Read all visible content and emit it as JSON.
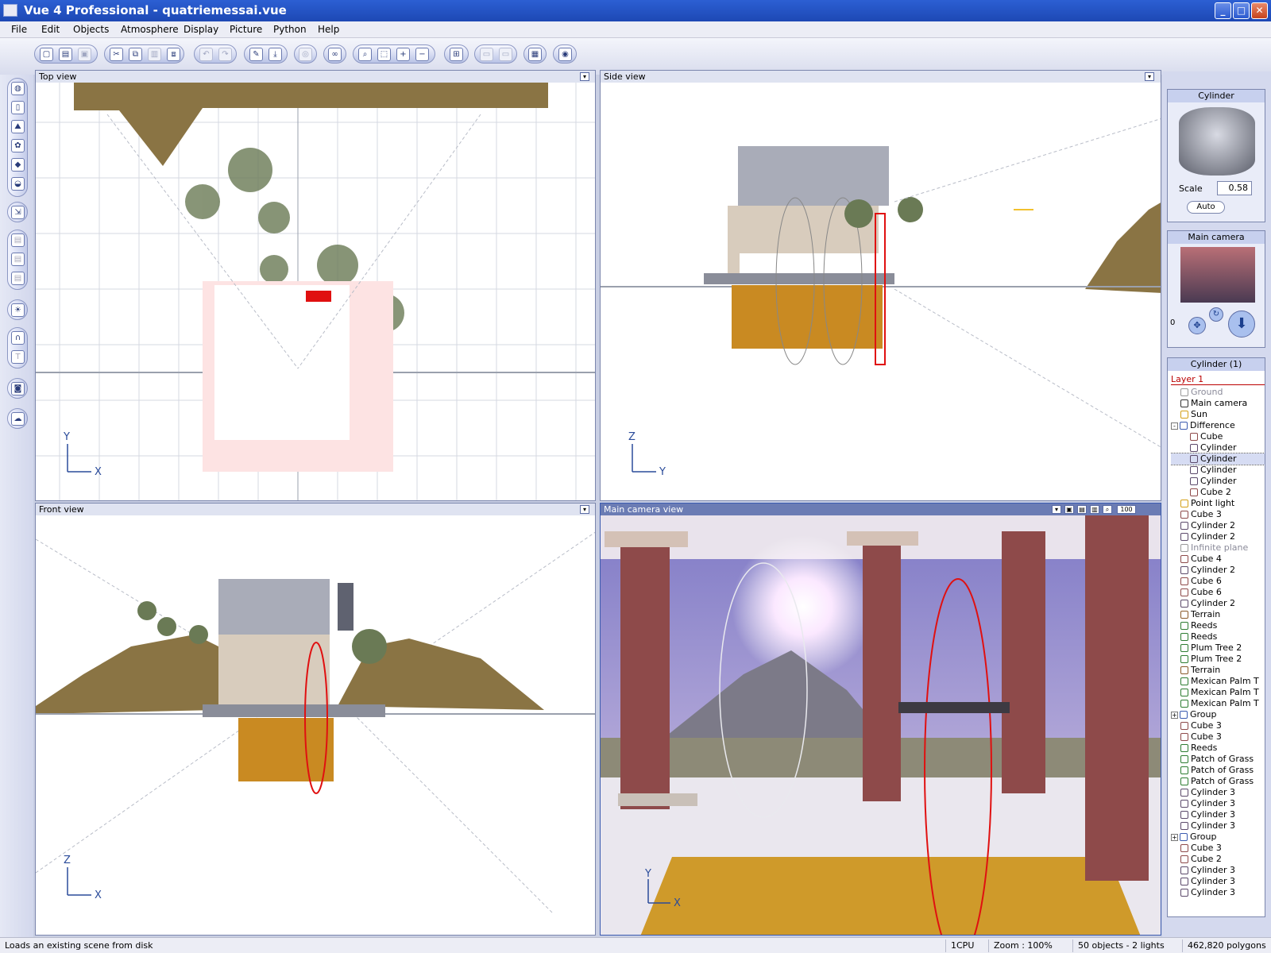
{
  "window": {
    "title": "Vue 4 Professional - quatriemessai.vue",
    "minimize_icon": "minimize-icon",
    "maximize_icon": "maximize-icon",
    "close_icon": "close-icon"
  },
  "menu": [
    "File",
    "Edit",
    "Objects",
    "Atmosphere",
    "Display",
    "Picture",
    "Python",
    "Help"
  ],
  "viewports": {
    "top": {
      "title": "Top view",
      "axis_v": "Y",
      "axis_h": "X"
    },
    "side": {
      "title": "Side view",
      "axis_v": "Z",
      "axis_h": "Y"
    },
    "front": {
      "title": "Front view",
      "axis_v": "Z",
      "axis_h": "X"
    },
    "camera": {
      "title": "Main camera view",
      "axis_v": "Y",
      "axis_h": "X",
      "zoom_label": "100"
    }
  },
  "object_preview": {
    "title": "Cylinder",
    "scale_label": "Scale",
    "scale_value": "0.58",
    "auto_label": "Auto"
  },
  "camera_panel": {
    "title": "Main camera",
    "counter": "0"
  },
  "world_browser": {
    "title": "Cylinder (1)",
    "layer": "Layer 1",
    "items": [
      {
        "name": "Ground",
        "indent": 1,
        "icon": "plane-icon",
        "dim": true
      },
      {
        "name": "Main camera",
        "indent": 1,
        "icon": "camera-icon"
      },
      {
        "name": "Sun",
        "indent": 1,
        "icon": "sun-icon"
      },
      {
        "name": "Difference",
        "indent": 1,
        "icon": "boolean-icon",
        "expander": "-"
      },
      {
        "name": "Cube",
        "indent": 2,
        "icon": "cube-icon"
      },
      {
        "name": "Cylinder",
        "indent": 2,
        "icon": "cylinder-icon"
      },
      {
        "name": "Cylinder",
        "indent": 2,
        "icon": "cylinder-icon",
        "selected": true
      },
      {
        "name": "Cylinder",
        "indent": 2,
        "icon": "cylinder-icon"
      },
      {
        "name": "Cylinder",
        "indent": 2,
        "icon": "cylinder-icon"
      },
      {
        "name": "Cube 2",
        "indent": 2,
        "icon": "cube-icon"
      },
      {
        "name": "Point light",
        "indent": 1,
        "icon": "light-icon"
      },
      {
        "name": "Cube 3",
        "indent": 1,
        "icon": "cube-icon"
      },
      {
        "name": "Cylinder 2",
        "indent": 1,
        "icon": "cylinder-icon"
      },
      {
        "name": "Cylinder 2",
        "indent": 1,
        "icon": "cylinder-icon"
      },
      {
        "name": "Infinite plane",
        "indent": 1,
        "icon": "plane-icon",
        "dim": true
      },
      {
        "name": "Cube 4",
        "indent": 1,
        "icon": "cube-icon"
      },
      {
        "name": "Cylinder 2",
        "indent": 1,
        "icon": "cylinder-icon"
      },
      {
        "name": "Cube 6",
        "indent": 1,
        "icon": "cube-icon"
      },
      {
        "name": "Cube 6",
        "indent": 1,
        "icon": "cube-icon"
      },
      {
        "name": "Cylinder 2",
        "indent": 1,
        "icon": "cylinder-icon"
      },
      {
        "name": "Terrain",
        "indent": 1,
        "icon": "terrain-icon"
      },
      {
        "name": "Reeds",
        "indent": 1,
        "icon": "plant-icon"
      },
      {
        "name": "Reeds",
        "indent": 1,
        "icon": "plant-icon"
      },
      {
        "name": "Plum Tree 2",
        "indent": 1,
        "icon": "plant-icon"
      },
      {
        "name": "Plum Tree 2",
        "indent": 1,
        "icon": "plant-icon"
      },
      {
        "name": "Terrain",
        "indent": 1,
        "icon": "terrain-icon"
      },
      {
        "name": "Mexican Palm T",
        "indent": 1,
        "icon": "plant-icon"
      },
      {
        "name": "Mexican Palm T",
        "indent": 1,
        "icon": "plant-icon"
      },
      {
        "name": "Mexican Palm T",
        "indent": 1,
        "icon": "plant-icon"
      },
      {
        "name": "Group",
        "indent": 1,
        "icon": "group-icon",
        "expander": "+"
      },
      {
        "name": "Cube 3",
        "indent": 1,
        "icon": "cube-icon"
      },
      {
        "name": "Cube 3",
        "indent": 1,
        "icon": "cube-icon"
      },
      {
        "name": "Reeds",
        "indent": 1,
        "icon": "plant-icon"
      },
      {
        "name": "Patch of Grass",
        "indent": 1,
        "icon": "plant-icon"
      },
      {
        "name": "Patch of Grass",
        "indent": 1,
        "icon": "plant-icon"
      },
      {
        "name": "Patch of Grass",
        "indent": 1,
        "icon": "plant-icon"
      },
      {
        "name": "Cylinder 3",
        "indent": 1,
        "icon": "cylinder-icon"
      },
      {
        "name": "Cylinder 3",
        "indent": 1,
        "icon": "cylinder-icon"
      },
      {
        "name": "Cylinder 3",
        "indent": 1,
        "icon": "cylinder-icon"
      },
      {
        "name": "Cylinder 3",
        "indent": 1,
        "icon": "cylinder-icon"
      },
      {
        "name": "Group",
        "indent": 1,
        "icon": "group-icon",
        "expander": "+"
      },
      {
        "name": "Cube 3",
        "indent": 1,
        "icon": "cube-icon"
      },
      {
        "name": "Cube 2",
        "indent": 1,
        "icon": "cube-icon"
      },
      {
        "name": "Cylinder 3",
        "indent": 1,
        "icon": "cylinder-icon"
      },
      {
        "name": "Cylinder 3",
        "indent": 1,
        "icon": "cylinder-icon"
      },
      {
        "name": "Cylinder 3",
        "indent": 1,
        "icon": "cylinder-icon"
      }
    ]
  },
  "status": {
    "message": "Loads an existing scene from disk",
    "cpu": "1CPU",
    "zoom": "Zoom : 100%",
    "objects": "50 objects - 2 lights",
    "polygons": "462,820 polygons"
  },
  "colors": {
    "titlebar": "#2c5fd3",
    "selection_red": "#e01010",
    "terrain": "#8a7444",
    "pillar": "#8e4a4a"
  }
}
